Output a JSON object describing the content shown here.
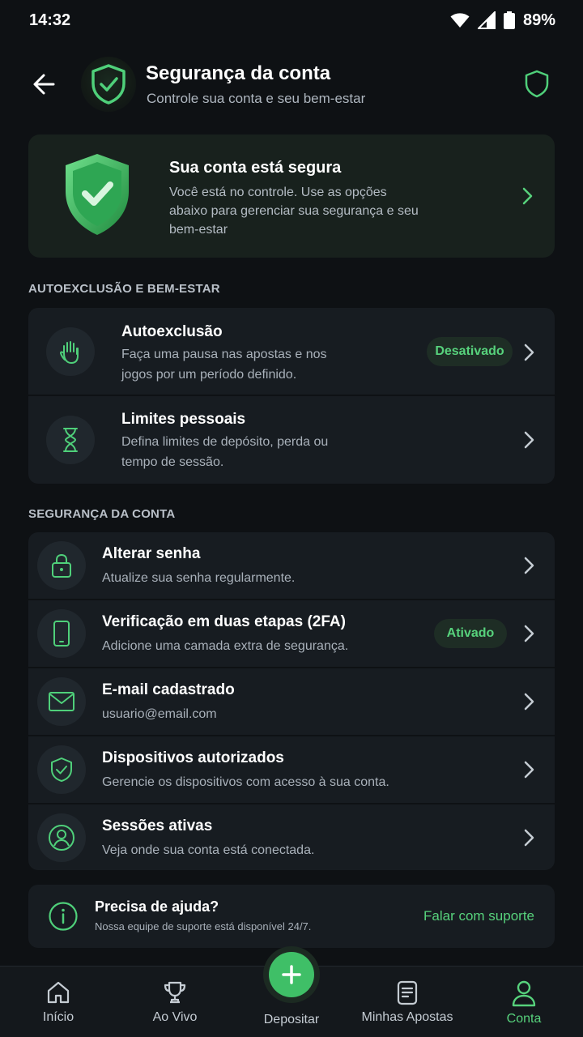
{
  "status": {
    "time": "14:32",
    "battery": "89%"
  },
  "header": {
    "title": "Segurança da conta",
    "subtitle": "Controle sua conta e seu bem-estar"
  },
  "hero": {
    "title": "Sua conta está segura",
    "text": "Você está no controle. Use as opções abaixo para gerenciar sua segurança e seu bem-estar"
  },
  "sections": {
    "wellbeing": {
      "label": "AUTOEXCLUSÃO E BEM-ESTAR",
      "items": [
        {
          "title": "Autoexclusão",
          "desc": "Faça uma pausa nas apostas e nos jogos por um período definido.",
          "status": "Desativado",
          "icon": "hand-icon"
        },
        {
          "title": "Limites pessoais",
          "desc": "Defina limites de depósito, perda ou tempo de sessão.",
          "icon": "hourglass-icon"
        }
      ]
    },
    "security": {
      "label": "SEGURANÇA DA CONTA",
      "items": [
        {
          "title": "Alterar senha",
          "desc": "Atualize sua senha regularmente.",
          "icon": "lock-icon"
        },
        {
          "title": "Verificação em duas etapas (2FA)",
          "desc": "Adicione uma camada extra de segurança.",
          "status": "Ativado",
          "icon": "phone-icon"
        },
        {
          "title": "E-mail cadastrado",
          "desc": "usuario@email.com",
          "icon": "mail-icon"
        },
        {
          "title": "Dispositivos autorizados",
          "desc": "Gerencie os dispositivos com acesso à sua conta.",
          "icon": "shield-check-icon"
        },
        {
          "title": "Sessões ativas",
          "desc": "Veja onde sua conta está conectada.",
          "icon": "user-circle-icon"
        }
      ]
    }
  },
  "help": {
    "title": "Precisa de ajuda?",
    "subtitle": "Nossa equipe de suporte está disponível 24/7.",
    "link": "Falar com suporte"
  },
  "nav": {
    "items": [
      {
        "label": "Início",
        "icon": "home-icon"
      },
      {
        "label": "Ao Vivo",
        "icon": "trophy-icon"
      },
      {
        "label": "Depositar",
        "icon": "plus-icon"
      },
      {
        "label": "Minhas Apostas",
        "icon": "document-icon"
      },
      {
        "label": "Conta",
        "icon": "user-icon",
        "active": true
      }
    ]
  },
  "colors": {
    "accent": "#57d27c",
    "background": "#0e1114",
    "card": "#171c21"
  }
}
